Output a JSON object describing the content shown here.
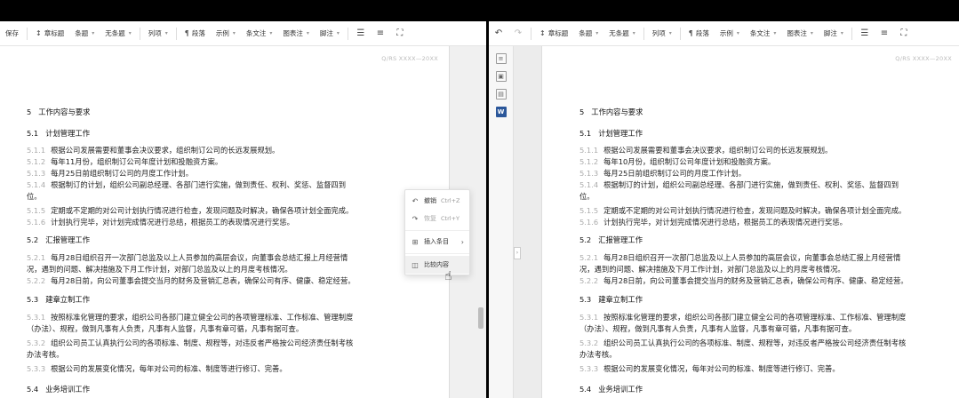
{
  "left_toolbar": {
    "items": [
      "保存",
      "章标题",
      "条题",
      "无条题",
      "列项",
      "段落",
      "示例",
      "条文注",
      "图表注",
      "脚注"
    ]
  },
  "right_toolbar": {
    "items": [
      "章标题",
      "条题",
      "无条题",
      "列项",
      "段落",
      "示例",
      "条文注",
      "图表注",
      "脚注"
    ]
  },
  "icons": {
    "undo": "undo-icon",
    "redo": "redo-icon",
    "align_left": "align-left-icon",
    "align_justify": "align-justify-icon",
    "fullscreen": "fullscreen-icon"
  },
  "document": {
    "std_code": "Q/RS XXXX—20XX",
    "section5": {
      "num": "5",
      "title": "工作内容与要求"
    },
    "s51": {
      "num": "5.1",
      "title": "计划管理工作"
    },
    "left_51": [
      {
        "num": "5.1.1",
        "text": "根据公司发展需要和董事会决议要求，组织制订公司的长远发展规划。"
      },
      {
        "num": "5.1.2",
        "text": "每年11月份，组织制订公司年度计划和投融资方案。"
      },
      {
        "num": "5.1.3",
        "text": "每月25日前组织制订公司的月度工作计划。"
      },
      {
        "num": "5.1.4",
        "text": "根据制订的计划，组织公司副总经理、各部门进行实施，做到责任、权利、奖惩、监督四到",
        "cont": "位。"
      },
      {
        "num": "5.1.5",
        "text": "定期或不定期的对公司计划执行情况进行检查，发现问题及时解决，确保各项计划全面完成。"
      },
      {
        "num": "5.1.6",
        "text": "计划执行完毕，对计划完成情况进行总结，根据员工的表现情况进行奖惩。"
      }
    ],
    "right_51": [
      {
        "num": "5.1.1",
        "text": "根据公司发展需要和董事会决议要求，组织制订公司的长远发展规划。"
      },
      {
        "num": "5.1.2",
        "text": "每年10月份，组织制订公司年度计划和投融资方案。"
      },
      {
        "num": "5.1.3",
        "text": "每月25日前组织制订公司的月度工作计划。"
      },
      {
        "num": "5.1.4",
        "text": "根据制订的计划，组织公司副总经理、各部门进行实施，做到责任、权利、奖惩、监督四到",
        "cont": "位。"
      },
      {
        "num": "5.1.5",
        "text": "定期或不定期的对公司计划执行情况进行检查，发现问题及时解决，确保各项计划全面完成。"
      },
      {
        "num": "5.1.6",
        "text": "计划执行完毕，对计划完成情况进行总结，根据员工的表现情况进行奖惩。"
      }
    ],
    "s52": {
      "num": "5.2",
      "title": "汇报管理工作"
    },
    "p521": {
      "num": "5.2.1",
      "text": "每月28日组织召开一次部门总监及以上人员参加的高层会议，向董事会总结汇报上月经营情",
      "cont": "况，遇到的问题、解决措施及下月工作计划，对部门总监及以上的月度考核情况。"
    },
    "p522": {
      "num": "5.2.2",
      "text": "每月28日前，向公司董事会提交当月的财务及营销汇总表，确保公司有序、健康、稳定经营。"
    },
    "s53": {
      "num": "5.3",
      "title": "建章立制工作"
    },
    "p531": {
      "num": "5.3.1",
      "text": "按照标准化管理的要求，组织公司各部门建立健全公司的各项管理标准、工作标准、管理制度",
      "cont": "（办法）、规程，做到凡事有人负责，凡事有人监督，凡事有章可循，凡事有据可查。"
    },
    "p532": {
      "num": "5.3.2",
      "text": "组织公司员工认真执行公司的各项标准、制度、规程等，对违反者严格按公司经济责任制考核",
      "cont": "办法考核。"
    },
    "p533": {
      "num": "5.3.3",
      "text": "根据公司的发展变化情况，每年对公司的标准、制度等进行修订、完善。"
    },
    "s54": {
      "num": "5.4",
      "title": "业务培训工作"
    }
  },
  "context_menu": {
    "undo": {
      "label": "撤销",
      "shortcut": "Ctrl+Z"
    },
    "redo": {
      "label": "恢复",
      "shortcut": "Ctrl+Y"
    },
    "insert": {
      "label": "插入条目"
    },
    "compare": {
      "label": "比较内容"
    }
  }
}
